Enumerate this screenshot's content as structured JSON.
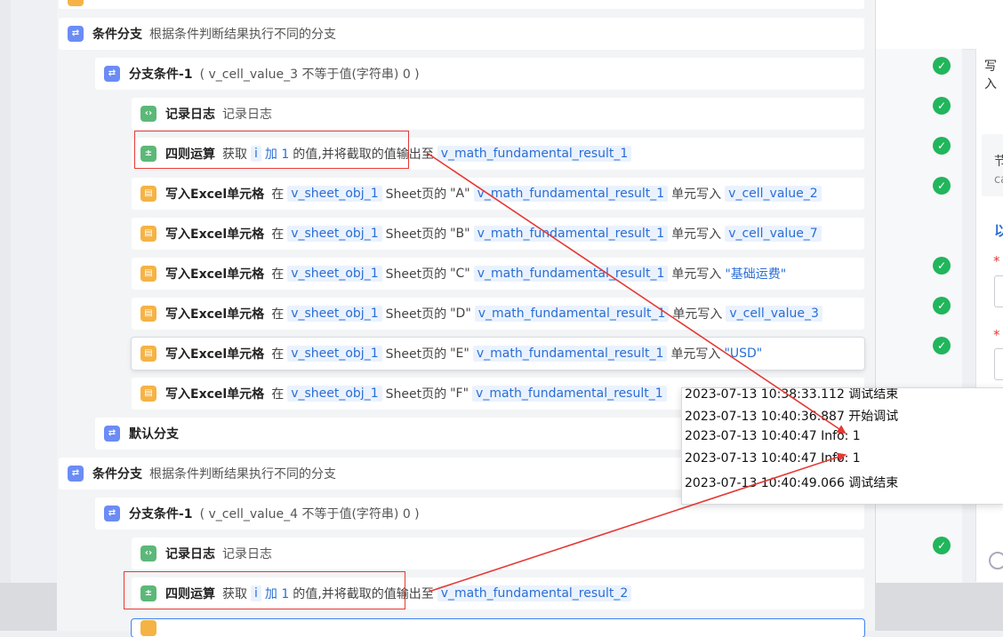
{
  "right_panel": {
    "header_label": "写入",
    "node_label": "节",
    "node_sub": "ca",
    "link_glyph": "以",
    "required_mark": "*"
  },
  "rows": [
    {
      "kind": "branch-root",
      "title": "条件分支",
      "desc": "根据条件判断结果执行不同的分支"
    },
    {
      "kind": "branch-cond",
      "title": "分支条件-1",
      "desc": "( v_cell_value_3 不等于值(字符串) 0 )"
    },
    {
      "kind": "log",
      "title": "记录日志",
      "desc": "记录日志"
    },
    {
      "kind": "math",
      "title": "四则运算",
      "pre": "获取",
      "var_i": "i",
      "op": "加 1",
      "mid": "的值,并将截取的值输出至",
      "result": "v_math_fundamental_result_1"
    },
    {
      "kind": "excel",
      "title": "写入Excel单元格",
      "in": "在",
      "sheet": "v_sheet_obj_1",
      "sheet_of": "Sheet页的",
      "col": "\"A\"",
      "result": "v_math_fundamental_result_1",
      "write": "单元写入",
      "value": "v_cell_value_2"
    },
    {
      "kind": "excel",
      "title": "写入Excel单元格",
      "in": "在",
      "sheet": "v_sheet_obj_1",
      "sheet_of": "Sheet页的",
      "col": "\"B\"",
      "result": "v_math_fundamental_result_1",
      "write": "单元写入",
      "value": "v_cell_value_7"
    },
    {
      "kind": "excel",
      "title": "写入Excel单元格",
      "in": "在",
      "sheet": "v_sheet_obj_1",
      "sheet_of": "Sheet页的",
      "col": "\"C\"",
      "result": "v_math_fundamental_result_1",
      "write": "单元写入",
      "value": "\"基础运费\""
    },
    {
      "kind": "excel",
      "title": "写入Excel单元格",
      "in": "在",
      "sheet": "v_sheet_obj_1",
      "sheet_of": "Sheet页的",
      "col": "\"D\"",
      "result": "v_math_fundamental_result_1",
      "write": "单元写入",
      "value": "v_cell_value_3"
    },
    {
      "kind": "excel",
      "title": "写入Excel单元格",
      "in": "在",
      "sheet": "v_sheet_obj_1",
      "sheet_of": "Sheet页的",
      "col": "\"E\"",
      "result": "v_math_fundamental_result_1",
      "write": "单元写入",
      "value": "\"USD\""
    },
    {
      "kind": "excel",
      "title": "写入Excel单元格",
      "in": "在",
      "sheet": "v_sheet_obj_1",
      "sheet_of": "Sheet页的",
      "col": "\"F\"",
      "result": "v_math_fundamental_result_1",
      "write": "单元写入",
      "value": ""
    },
    {
      "kind": "default",
      "title": "默认分支"
    },
    {
      "kind": "branch-root",
      "title": "条件分支",
      "desc": "根据条件判断结果执行不同的分支"
    },
    {
      "kind": "branch-cond",
      "title": "分支条件-1",
      "desc": "( v_cell_value_4 不等于值(字符串) 0 )"
    },
    {
      "kind": "log",
      "title": "记录日志",
      "desc": "记录日志"
    },
    {
      "kind": "math",
      "title": "四则运算",
      "pre": "获取",
      "var_i": "i",
      "op": "加 1",
      "mid": "的值,并将截取的值输出至",
      "result": "v_math_fundamental_result_2"
    }
  ],
  "log_popup": {
    "lines": [
      "2023-07-13 10:38:33.112 调试结束",
      "2023-07-13 10:40:36.887 开始调试",
      "2023-07-13 10:40:47 Info: 1",
      "2023-07-13 10:40:47 Info: 1",
      "2023-07-13 10:40:49.066 调试结束"
    ]
  },
  "status": {
    "check_glyph": "✓",
    "success_color": "#21b55c"
  },
  "colors": {
    "annotation": "#e53935",
    "accent_blue": "#2a6ed6",
    "chip_bg": "#eaf2fd",
    "icon_blue": "#6b8cf5",
    "icon_green": "#5cb878",
    "icon_orange": "#f5b345"
  }
}
